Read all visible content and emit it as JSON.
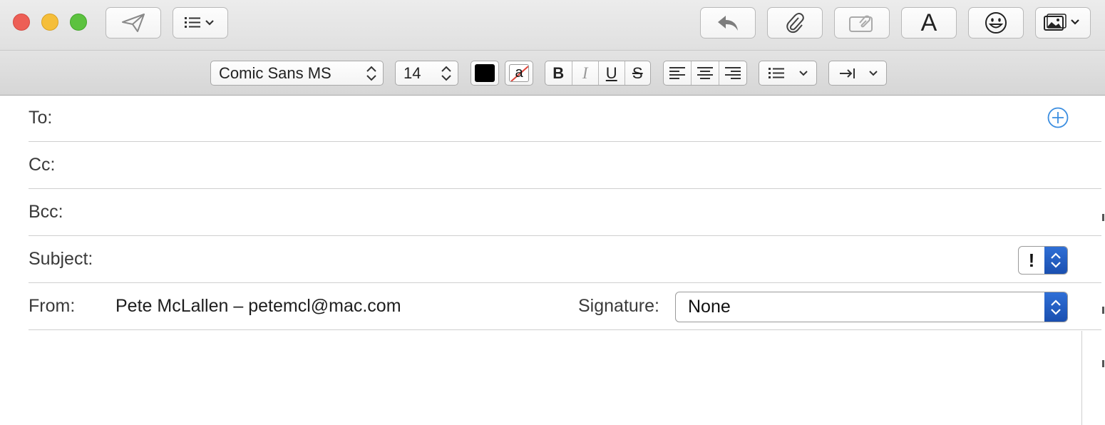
{
  "toolbar": {
    "buttons": [
      {
        "name": "send-button",
        "icon": "paper-plane-icon"
      },
      {
        "name": "header-fields-menu",
        "icon": "list-chevron-icon"
      },
      {
        "name": "reply-button",
        "icon": "reply-arrow-icon"
      },
      {
        "name": "attach-button",
        "icon": "paperclip-icon"
      },
      {
        "name": "markup-button",
        "icon": "markup-icon"
      },
      {
        "name": "fonts-button",
        "icon": "letter-a-icon",
        "label": "A"
      },
      {
        "name": "emoji-button",
        "icon": "smiley-icon"
      },
      {
        "name": "photo-browser-button",
        "icon": "photo-icon"
      }
    ]
  },
  "format": {
    "font_family": "Comic Sans MS",
    "font_size": "14",
    "text_color": "#000000",
    "bold_label": "B",
    "italic_label": "I",
    "underline_label": "U",
    "strike_label": "S",
    "background_color_label": "a"
  },
  "fields": {
    "to_label": "To:",
    "cc_label": "Cc:",
    "bcc_label": "Bcc:",
    "subject_label": "Subject:",
    "priority_mark": "!",
    "from_label": "From:",
    "from_value": "Pete McLallen – petemcl@mac.com",
    "signature_label": "Signature:",
    "signature_value": "None"
  },
  "colors": {
    "accent": "#1a4fb0",
    "close": "#ed5f56",
    "minimize": "#f5be3a",
    "maximize": "#5cc23f"
  }
}
